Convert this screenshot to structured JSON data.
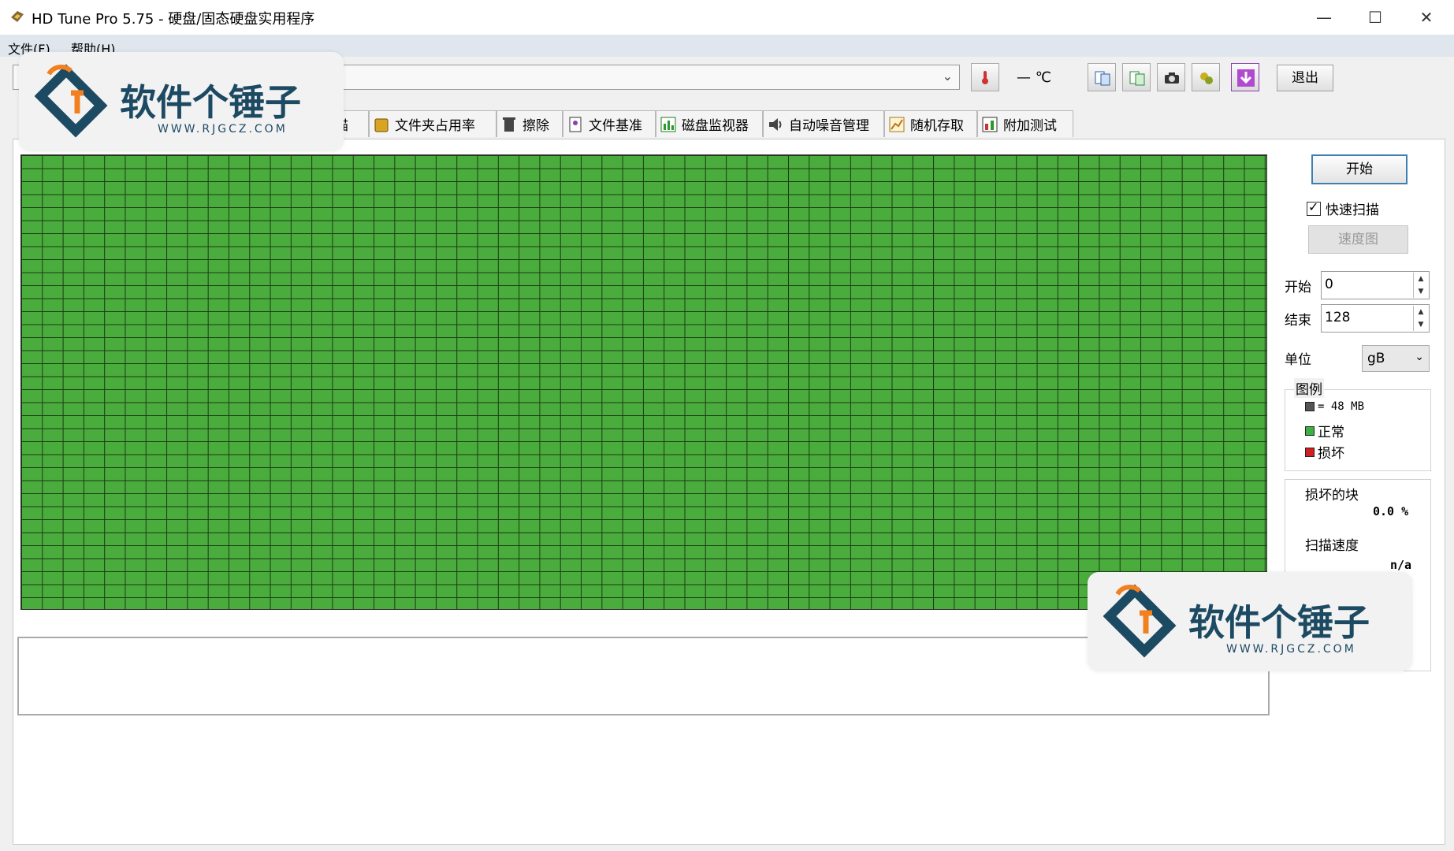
{
  "window": {
    "title": "HD Tune Pro 5.75 - 硬盘/固态硬盘实用程序",
    "minimize": "—",
    "maximize": "☐",
    "close": "✕"
  },
  "menu": {
    "file": "文件(F)",
    "help": "帮助(H)"
  },
  "toolbar": {
    "temperature": "— ℃",
    "exit_label": "退出",
    "icons": [
      "copy-info-icon",
      "copy-info2-icon",
      "camera-icon",
      "options-icon",
      "download-icon"
    ]
  },
  "tabs": [
    {
      "label": "描",
      "icon": "scan-icon"
    },
    {
      "label": "文件夹占用率",
      "icon": "folder-icon"
    },
    {
      "label": "擦除",
      "icon": "trash-icon"
    },
    {
      "label": "文件基准",
      "icon": "file-benchmark-icon"
    },
    {
      "label": "磁盘监视器",
      "icon": "monitor-icon"
    },
    {
      "label": "自动噪音管理",
      "icon": "speaker-icon"
    },
    {
      "label": "随机存取",
      "icon": "random-access-icon"
    },
    {
      "label": "附加测试",
      "icon": "extra-tests-icon"
    }
  ],
  "scan": {
    "start_button": "开始",
    "quick_scan_label": "快速扫描",
    "quick_scan_checked": true,
    "speed_map_button": "速度图",
    "start_label": "开始",
    "start_value": "0",
    "end_label": "结束",
    "end_value": "128",
    "unit_label": "单位",
    "unit_value": "gB"
  },
  "legend": {
    "title": "图例",
    "block_size": "= 48 MB",
    "normal": "正常",
    "damaged": "损坏",
    "colors": {
      "block": "#555555",
      "normal": "#3cb043",
      "damaged": "#d02020"
    }
  },
  "stats": {
    "damaged_blocks_label": "损坏的块",
    "damaged_blocks_value": "0.0 %",
    "scan_speed_label": "扫描速度",
    "scan_speed_value": "n/a"
  },
  "watermark": {
    "name": "软件个锤子",
    "url": "WWW.RJGCZ.COM"
  },
  "colors": {
    "grid_green": "#4aac3c",
    "accent_blue": "#3c7fb1"
  }
}
